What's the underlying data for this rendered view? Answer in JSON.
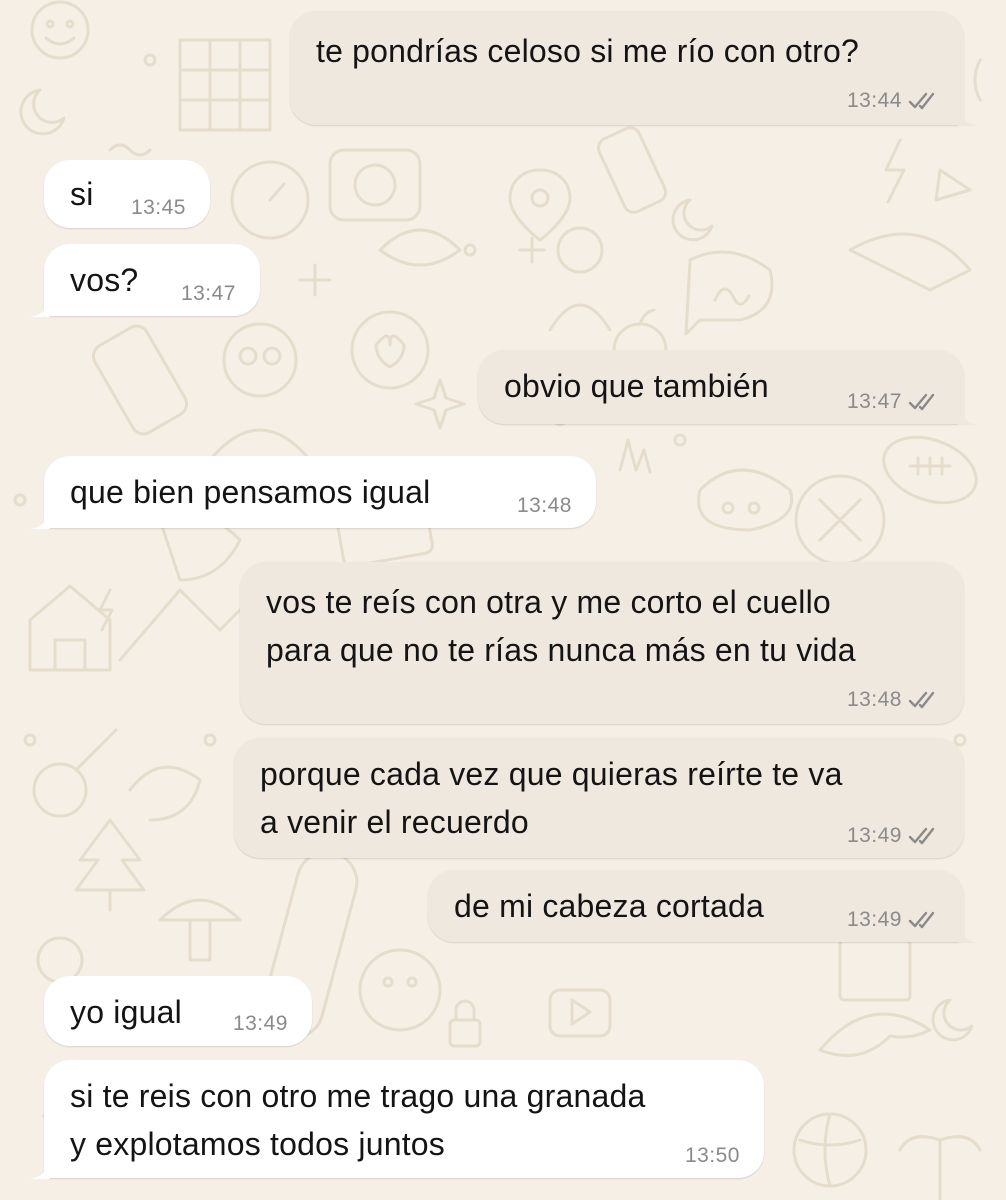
{
  "colors": {
    "wallpaper": "#f5efe6",
    "wallpaper_doodle": "#e9e0d2",
    "incoming_bubble": "#ffffff",
    "outgoing_bubble": "#efe8de",
    "text": "#141414",
    "timestamp": "#8a8a8a"
  },
  "messages": [
    {
      "direction": "outgoing",
      "text": "te pondrías celoso si me río con otro?",
      "time": "13:44",
      "status_icon": "double-check-icon"
    },
    {
      "direction": "incoming",
      "text": "si",
      "time": "13:45"
    },
    {
      "direction": "incoming",
      "text": "vos?",
      "time": "13:47"
    },
    {
      "direction": "outgoing",
      "text": "obvio que también",
      "time": "13:47",
      "status_icon": "double-check-icon"
    },
    {
      "direction": "incoming",
      "text": "que bien pensamos igual",
      "time": "13:48"
    },
    {
      "direction": "outgoing",
      "text": "vos te reís con otra y me corto el cuello\npara que no te rías nunca más en tu vida",
      "time": "13:48",
      "status_icon": "double-check-icon"
    },
    {
      "direction": "outgoing",
      "text": "porque cada vez que quieras reírte te va\na venir el recuerdo",
      "time": "13:49",
      "status_icon": "double-check-icon"
    },
    {
      "direction": "outgoing",
      "text": "de mi cabeza cortada",
      "time": "13:49",
      "status_icon": "double-check-icon"
    },
    {
      "direction": "incoming",
      "text": "yo igual",
      "time": "13:49"
    },
    {
      "direction": "incoming",
      "text": "si te reis con otro me trago una granada\ny explotamos todos juntos",
      "time": "13:50"
    }
  ]
}
